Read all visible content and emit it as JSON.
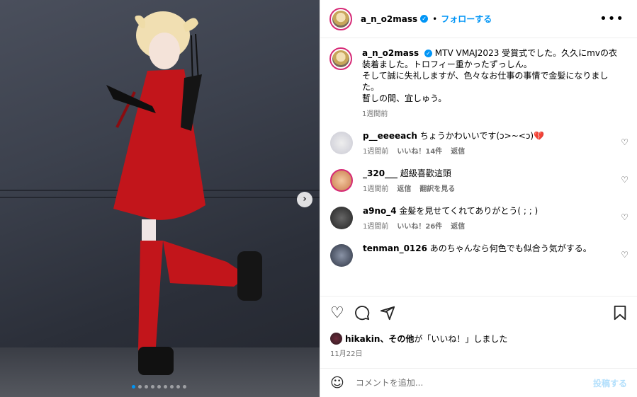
{
  "header": {
    "username": "a_n_o2mass",
    "separator": "•",
    "follow_label": "フォローする",
    "more_icon": "•••"
  },
  "caption": {
    "username": "a_n_o2mass",
    "text_line1": "MTV VMAJ2023 受賞式でした。久久にmvの衣装着ました。トロフィー重かったずっしん。",
    "text_line2": "そして誠に失礼しますが、色々なお仕事の事情で金髪になりました。",
    "text_line3": "暫しの間、宜しゅう。",
    "time": "1週間前"
  },
  "comments": [
    {
      "username": "p__eeeeach",
      "text": "ちょうかわいいです(ↄ>~<ↄ)💔",
      "time": "1週間前",
      "likes": "いいね！14件",
      "reply": "返信",
      "translate": ""
    },
    {
      "username": "_320___",
      "text": "超級喜歡這頭",
      "time": "1週間前",
      "likes": "",
      "reply": "返信",
      "translate": "翻訳を見る"
    },
    {
      "username": "a9no_4",
      "text": "金髪を見せてくれてありがとう( ; ; )",
      "time": "1週間前",
      "likes": "いいね！26件",
      "reply": "返信",
      "translate": ""
    },
    {
      "username": "tenman_0126",
      "text": "あのちゃんなら何色でも似合う気がする。",
      "time": "",
      "likes": "",
      "reply": "",
      "translate": ""
    }
  ],
  "likes_line": {
    "user": "hikakin",
    "and_others": "、その他",
    "suffix": "が「いいね！」しました"
  },
  "post_date": "11月22日",
  "add_comment": {
    "placeholder": "コメントを追加...",
    "post_label": "投稿する"
  },
  "icons": {
    "next": "›",
    "like": "heart-icon",
    "comment": "comment-icon",
    "share": "share-icon",
    "save": "bookmark-icon",
    "emoji": "emoji-icon"
  },
  "carousel": {
    "total": 9,
    "active": 1
  },
  "colors": {
    "accent": "#0095f6",
    "ring": "#d62976",
    "post_disabled": "#b2dffc",
    "meta": "#737373"
  }
}
